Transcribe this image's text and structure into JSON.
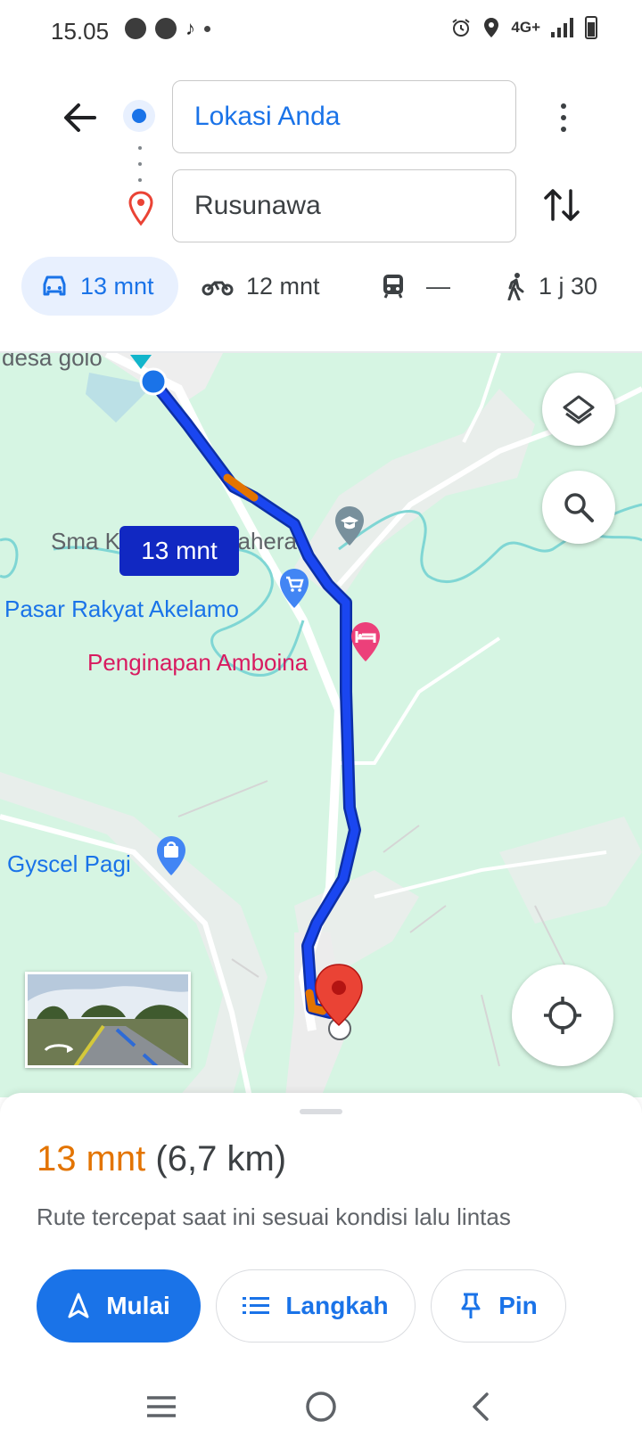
{
  "status_bar": {
    "time": "15.05",
    "network": "4G+",
    "icons": [
      "speedometer-icon",
      "speedometer-icon",
      "tiktok-icon",
      "alarm-icon",
      "location-icon",
      "signal-icon",
      "battery-icon"
    ]
  },
  "directions": {
    "origin": "Lokasi Anda",
    "destination": "Rusunawa",
    "modes": [
      {
        "icon": "car-icon",
        "label": "13 mnt",
        "selected": true
      },
      {
        "icon": "motorcycle-icon",
        "label": "12 mnt"
      },
      {
        "icon": "transit-icon",
        "label": "—"
      },
      {
        "icon": "walk-icon",
        "label": "1 j 30"
      }
    ]
  },
  "map": {
    "labels": {
      "desa": "desa golo",
      "sma": "Sma Kristen Halmahera",
      "pasar": "Pasar Rakyat Akelamo",
      "penginapan": "Penginapan Amboina",
      "gyscel": "Gyscel Pagi"
    },
    "route_time": "13 mnt",
    "colors": {
      "route": "#1a46f0",
      "land": "#d6f5e3",
      "road": "#ececec",
      "river": "#7fd6d4"
    }
  },
  "sheet": {
    "time": "13 mnt",
    "distance": "(6,7 km)",
    "description": "Rute tercepat saat ini sesuai kondisi lalu lintas",
    "start_label": "Mulai",
    "steps_label": "Langkah",
    "pin_label": "Pin"
  },
  "colors": {
    "accent": "#1a73e8",
    "time_orange": "#e37400",
    "destination_red": "#ea4335"
  }
}
